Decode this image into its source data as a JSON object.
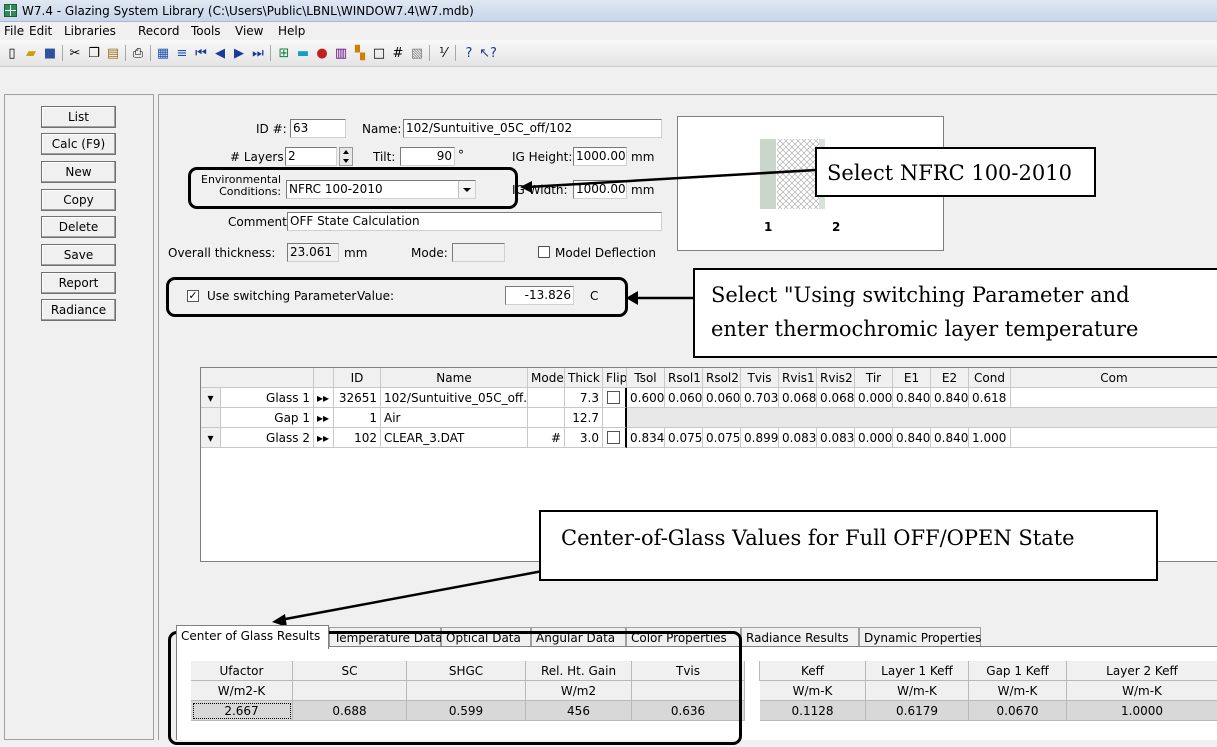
{
  "window": {
    "title": "W7.4 - Glazing System Library (C:\\Users\\Public\\LBNL\\WINDOW7.4\\W7.mdb)"
  },
  "menu": [
    "File",
    "Edit",
    "Libraries",
    "Record",
    "Tools",
    "View",
    "Help"
  ],
  "toolbar_icons": [
    "new-icon",
    "open-icon",
    "save-icon",
    "cut-icon",
    "copy-icon",
    "paste-icon",
    "print-icon",
    "list-view-icon",
    "form-view-icon",
    "first-record-icon",
    "previous-record-icon",
    "next-record-icon",
    "last-record-icon",
    "grid-icon",
    "color-icon",
    "pin-icon",
    "columns-icon",
    "chart-icon",
    "square-icon",
    "hash-icon",
    "hatch-icon",
    "fraction-icon",
    "help-icon",
    "context-help-icon"
  ],
  "left_buttons": [
    "List",
    "Calc (F9)",
    "New",
    "Copy",
    "Delete",
    "Save",
    "Report",
    "Radiance"
  ],
  "form": {
    "id_label": "ID #:",
    "id_value": "63",
    "name_label": "Name:",
    "name_value": "102/Suntuitive_05C_off/102",
    "layers_label": "# Layers:",
    "layers_value": "2",
    "tilt_label": "Tilt:",
    "tilt_value": "90",
    "tilt_unit": "°",
    "ig_height_label": "IG Height:",
    "ig_height_value": "1000.00",
    "ig_height_unit": "mm",
    "env_label_1": "Environmental",
    "env_label_2": "Conditions:",
    "env_value": "NFRC 100-2010",
    "ig_width_label": "IG Width:",
    "ig_width_value": "1000.00",
    "ig_width_unit": "mm",
    "comment_label": "Comment:",
    "comment_value": "OFF State Calculation",
    "thickness_label": "Overall thickness:",
    "thickness_value": "23.061",
    "thickness_unit": "mm",
    "mode_label": "Mode:",
    "mode_value": "",
    "deflection_label": "Model Deflection",
    "switch_label": "Use switching Parameter",
    "switch_value_label": "Value:",
    "switch_value": "-13.826",
    "switch_unit": "C",
    "preview_labels": [
      "1",
      "2"
    ]
  },
  "layers_table": {
    "headers": [
      "",
      "",
      "ID",
      "Name",
      "Mode",
      "Thick",
      "Flip",
      "Tsol",
      "Rsol1",
      "Rsol2",
      "Tvis",
      "Rvis1",
      "Rvis2",
      "Tir",
      "E1",
      "E2",
      "Cond",
      "Com"
    ],
    "rows": [
      [
        "Glass 1",
        "32651",
        "102/Suntuitive_05C_off.",
        "",
        "7.3",
        "0.600",
        "0.060",
        "0.060",
        "0.703",
        "0.068",
        "0.068",
        "0.000",
        "0.840",
        "0.840",
        "0.618"
      ],
      [
        "Gap 1",
        "1",
        "Air",
        "",
        "12.7",
        "",
        "",
        "",
        "",
        "",
        "",
        "",
        "",
        "",
        ""
      ],
      [
        "Glass 2",
        "102",
        "CLEAR_3.DAT",
        "#",
        "3.0",
        "0.834",
        "0.075",
        "0.075",
        "0.899",
        "0.083",
        "0.083",
        "0.000",
        "0.840",
        "0.840",
        "1.000"
      ]
    ]
  },
  "tabs": [
    "Center of Glass Results",
    "Temperature Data",
    "Optical Data",
    "Angular Data",
    "Color Properties",
    "Radiance Results",
    "Dynamic Properties"
  ],
  "results": {
    "headers": [
      "Ufactor",
      "SC",
      "SHGC",
      "Rel. Ht. Gain",
      "Tvis",
      "Keff",
      "Layer 1 Keff",
      "Gap 1 Keff",
      "Layer 2 Keff"
    ],
    "units": [
      "W/m2-K",
      "",
      "",
      "W/m2",
      "",
      "W/m-K",
      "W/m-K",
      "W/m-K",
      "W/m-K"
    ],
    "values": [
      "2.667",
      "0.688",
      "0.599",
      "456",
      "0.636",
      "0.1128",
      "0.6179",
      "0.0670",
      "1.0000"
    ]
  },
  "annotations": {
    "nfrc": "Select NFRC 100-2010",
    "switch_1": "Select \"Using switching Parameter and",
    "switch_2": "enter thermochromic layer temperature",
    "center": "Center-of-Glass Values for Full OFF/OPEN State"
  }
}
